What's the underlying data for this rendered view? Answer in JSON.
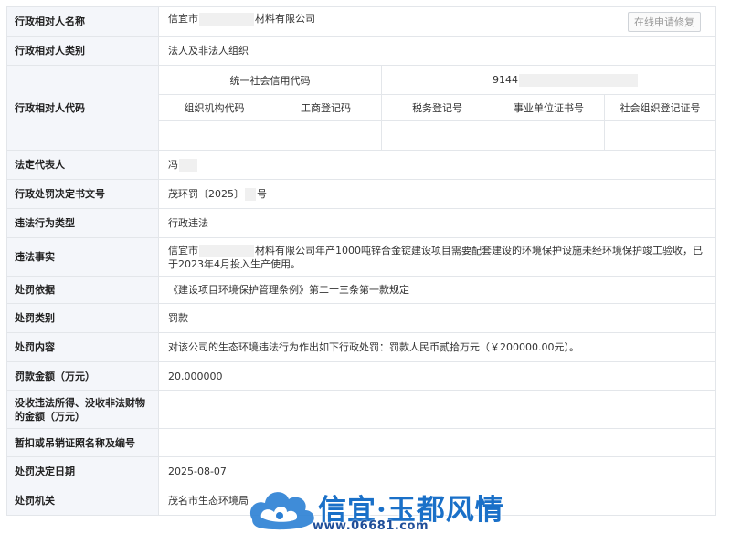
{
  "repair_button": "在线申请修复",
  "rows": {
    "name": {
      "label": "行政相对人名称",
      "value_pre": "信宜市",
      "value_post": "材料有限公司"
    },
    "category": {
      "label": "行政相对人类别",
      "value": "法人及非法人组织"
    },
    "code": {
      "label": "行政相对人代码",
      "credit_code_label": "统一社会信用代码",
      "credit_code_value": "9144",
      "sub_headers": [
        "组织机构代码",
        "工商登记码",
        "税务登记号",
        "事业单位证书号",
        "社会组织登记证号"
      ]
    },
    "legal_rep": {
      "label": "法定代表人",
      "value": "冯"
    },
    "doc_no": {
      "label": "行政处罚决定书文号",
      "value_pre": "茂环罚〔2025〕",
      "value_post": "号"
    },
    "violation_type": {
      "label": "违法行为类型",
      "value": "行政违法"
    },
    "facts": {
      "label": "违法事实",
      "value_pre": "信宜市",
      "value_post": "材料有限公司年产1000吨锌合金锭建设项目需要配套建设的环境保护设施未经环境保护竣工验收，已于2023年4月投入生产使用。"
    },
    "basis": {
      "label": "处罚依据",
      "value": "《建设项目环境保护管理条例》第二十三条第一款规定"
    },
    "penalty_type": {
      "label": "处罚类别",
      "value": "罚款"
    },
    "content": {
      "label": "处罚内容",
      "value": "对该公司的生态环境违法行为作出如下行政处罚：罚款人民币贰拾万元（￥200000.00元）。"
    },
    "amount": {
      "label": "罚款金额（万元）",
      "value": "20.000000"
    },
    "confiscation": {
      "label": "没收违法所得、没收非法财物的金额（万元）",
      "value": ""
    },
    "license": {
      "label": "暂扣或吊销证照名称及编号",
      "value": ""
    },
    "date": {
      "label": "处罚决定日期",
      "value": "2025-08-07"
    },
    "authority": {
      "label": "处罚机关",
      "value": "茂名市生态环境局"
    }
  },
  "watermark": {
    "title": "信宜·玉都风情",
    "url": "www.06681.com"
  }
}
